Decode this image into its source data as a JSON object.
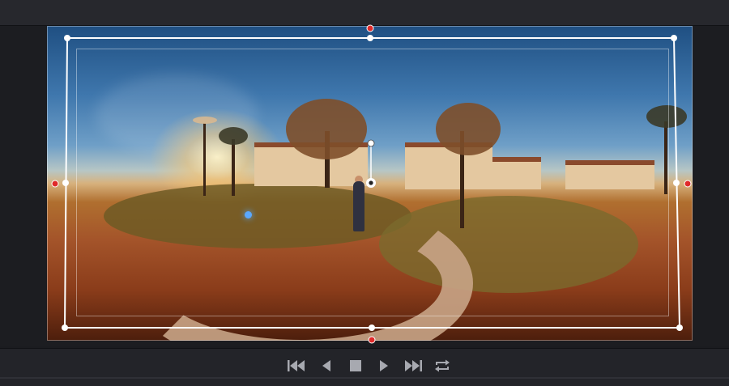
{
  "viewer": {
    "image": "360-equirectangular-street-scene",
    "overlay_color": "#ffffff",
    "handle_accent": "#e02a2a"
  },
  "transport": {
    "buttons": [
      {
        "name": "skip-to-start",
        "icon": "skip-back-icon"
      },
      {
        "name": "step-back",
        "icon": "play-reverse-icon"
      },
      {
        "name": "stop",
        "icon": "stop-icon"
      },
      {
        "name": "play",
        "icon": "play-icon"
      },
      {
        "name": "skip-to-end",
        "icon": "skip-forward-icon"
      },
      {
        "name": "loop",
        "icon": "loop-icon"
      }
    ],
    "icon_color": "#a7a9b0"
  }
}
